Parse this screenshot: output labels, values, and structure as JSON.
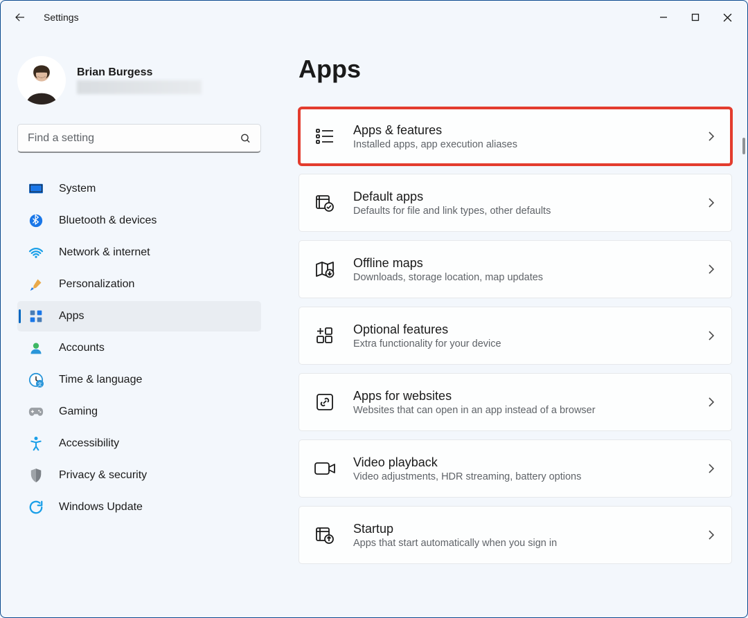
{
  "titlebar": {
    "title": "Settings"
  },
  "profile": {
    "name": "Brian Burgess"
  },
  "search": {
    "placeholder": "Find a setting"
  },
  "sidebar": {
    "items": [
      {
        "label": "System",
        "icon": "system-icon"
      },
      {
        "label": "Bluetooth & devices",
        "icon": "bluetooth-icon"
      },
      {
        "label": "Network & internet",
        "icon": "wifi-icon"
      },
      {
        "label": "Personalization",
        "icon": "brush-icon"
      },
      {
        "label": "Apps",
        "icon": "apps-icon"
      },
      {
        "label": "Accounts",
        "icon": "accounts-icon"
      },
      {
        "label": "Time & language",
        "icon": "time-icon"
      },
      {
        "label": "Gaming",
        "icon": "gaming-icon"
      },
      {
        "label": "Accessibility",
        "icon": "accessibility-icon"
      },
      {
        "label": "Privacy & security",
        "icon": "privacy-icon"
      },
      {
        "label": "Windows Update",
        "icon": "update-icon"
      }
    ]
  },
  "page": {
    "title": "Apps"
  },
  "cards": [
    {
      "title": "Apps & features",
      "sub": "Installed apps, app execution aliases",
      "icon": "apps-features-icon",
      "highlight": true
    },
    {
      "title": "Default apps",
      "sub": "Defaults for file and link types, other defaults",
      "icon": "default-apps-icon"
    },
    {
      "title": "Offline maps",
      "sub": "Downloads, storage location, map updates",
      "icon": "map-icon"
    },
    {
      "title": "Optional features",
      "sub": "Extra functionality for your device",
      "icon": "plus-grid-icon"
    },
    {
      "title": "Apps for websites",
      "sub": "Websites that can open in an app instead of a browser",
      "icon": "link-square-icon"
    },
    {
      "title": "Video playback",
      "sub": "Video adjustments, HDR streaming, battery options",
      "icon": "video-icon"
    },
    {
      "title": "Startup",
      "sub": "Apps that start automatically when you sign in",
      "icon": "startup-icon"
    }
  ]
}
